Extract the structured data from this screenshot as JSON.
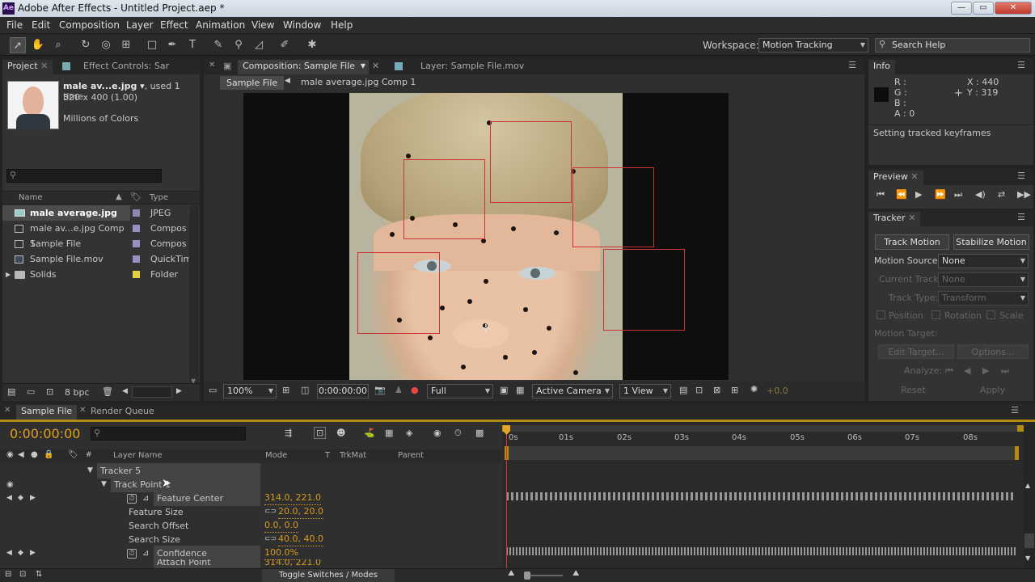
{
  "window": {
    "title": "Adobe After Effects - Untitled Project.aep *",
    "app_icon": "Ae",
    "buttons": [
      "—",
      "▭",
      "✕"
    ]
  },
  "menu": [
    "File",
    "Edit",
    "Composition",
    "Layer",
    "Effect",
    "Animation",
    "View",
    "Window",
    "Help"
  ],
  "toolbar": {
    "workspace_label": "Workspace:",
    "workspace_value": "Motion Tracking",
    "search_placeholder": "Search Help"
  },
  "project": {
    "tab_project": "Project",
    "tab_effects": "Effect Controls: Sar",
    "item_name": "male av...e.jpg ▾",
    "item_used": ", used 1 time",
    "item_dims": "320 x 400 (1.00)",
    "item_colors": "Millions of Colors",
    "col_name": "Name",
    "col_type": "Type",
    "bpc": "8 bpc",
    "items": [
      {
        "name": "male average.jpg",
        "type": "JPEG",
        "color": "#8f86b4"
      },
      {
        "name": "male av...e.jpg Comp 1",
        "type": "Compos",
        "color": "#9a8fc4"
      },
      {
        "name": "Sample File",
        "type": "Compos",
        "color": "#9a8fc4"
      },
      {
        "name": "Sample File.mov",
        "type": "QuickTim",
        "color": "#9a8fc4"
      },
      {
        "name": "Solids",
        "type": "Folder",
        "color": "#e6cf3c"
      }
    ]
  },
  "comp": {
    "tab_comp": "Composition: Sample File",
    "tab_layer": "Layer: Sample File.mov",
    "crumb1": "Sample File",
    "crumb2": "male average.jpg Comp 1",
    "zoom": "100%",
    "timecode": "0:00:00:00",
    "resolution": "Full",
    "camera": "Active Camera",
    "views": "1 View",
    "exposure": "+0.0"
  },
  "info": {
    "tab": "Info",
    "r": "R :",
    "g": "G :",
    "b": "B :",
    "a": "A : 0",
    "x": "X : 440",
    "y": "Y : 319",
    "status": "Setting tracked keyframes"
  },
  "preview": {
    "tab": "Preview"
  },
  "tracker": {
    "tab": "Tracker",
    "track_motion": "Track Motion",
    "stabilize_motion": "Stabilize Motion",
    "motion_source_label": "Motion Source:",
    "motion_source_value": "None",
    "current_track_label": "Current Track:",
    "current_track_value": "None",
    "track_type_label": "Track Type:",
    "track_type_value": "Transform",
    "position": "Position",
    "rotation": "Rotation",
    "scale": "Scale",
    "motion_target": "Motion Target:",
    "edit_target": "Edit Target...",
    "options": "Options...",
    "analyze": "Analyze:",
    "reset": "Reset",
    "apply": "Apply"
  },
  "timeline": {
    "tab_sample": "Sample File",
    "tab_render": "Render Queue",
    "timecode": "0:00:00:00",
    "col_layer": "Layer Name",
    "col_mode": "Mode",
    "col_t": "T",
    "col_trkmat": "TrkMat",
    "col_parent": "Parent",
    "toggle": "Toggle Switches / Modes",
    "ruler": [
      "0s",
      "01s",
      "02s",
      "03s",
      "04s",
      "05s",
      "06s",
      "07s",
      "08s"
    ],
    "rows": {
      "tracker": "Tracker 5",
      "trackpoint": "Track Point 1",
      "feature_center": "Feature Center",
      "feature_center_val": "314.0, 221.0",
      "feature_size": "Feature Size",
      "feature_size_val": "20.0, 20.0",
      "search_offset": "Search Offset",
      "search_offset_val": "0.0, 0.0",
      "search_size": "Search Size",
      "search_size_val": "40.0, 40.0",
      "confidence": "Confidence",
      "confidence_val": "100.0%",
      "attach": "Attach Point",
      "attach_val": "314.0, 221.0"
    }
  }
}
